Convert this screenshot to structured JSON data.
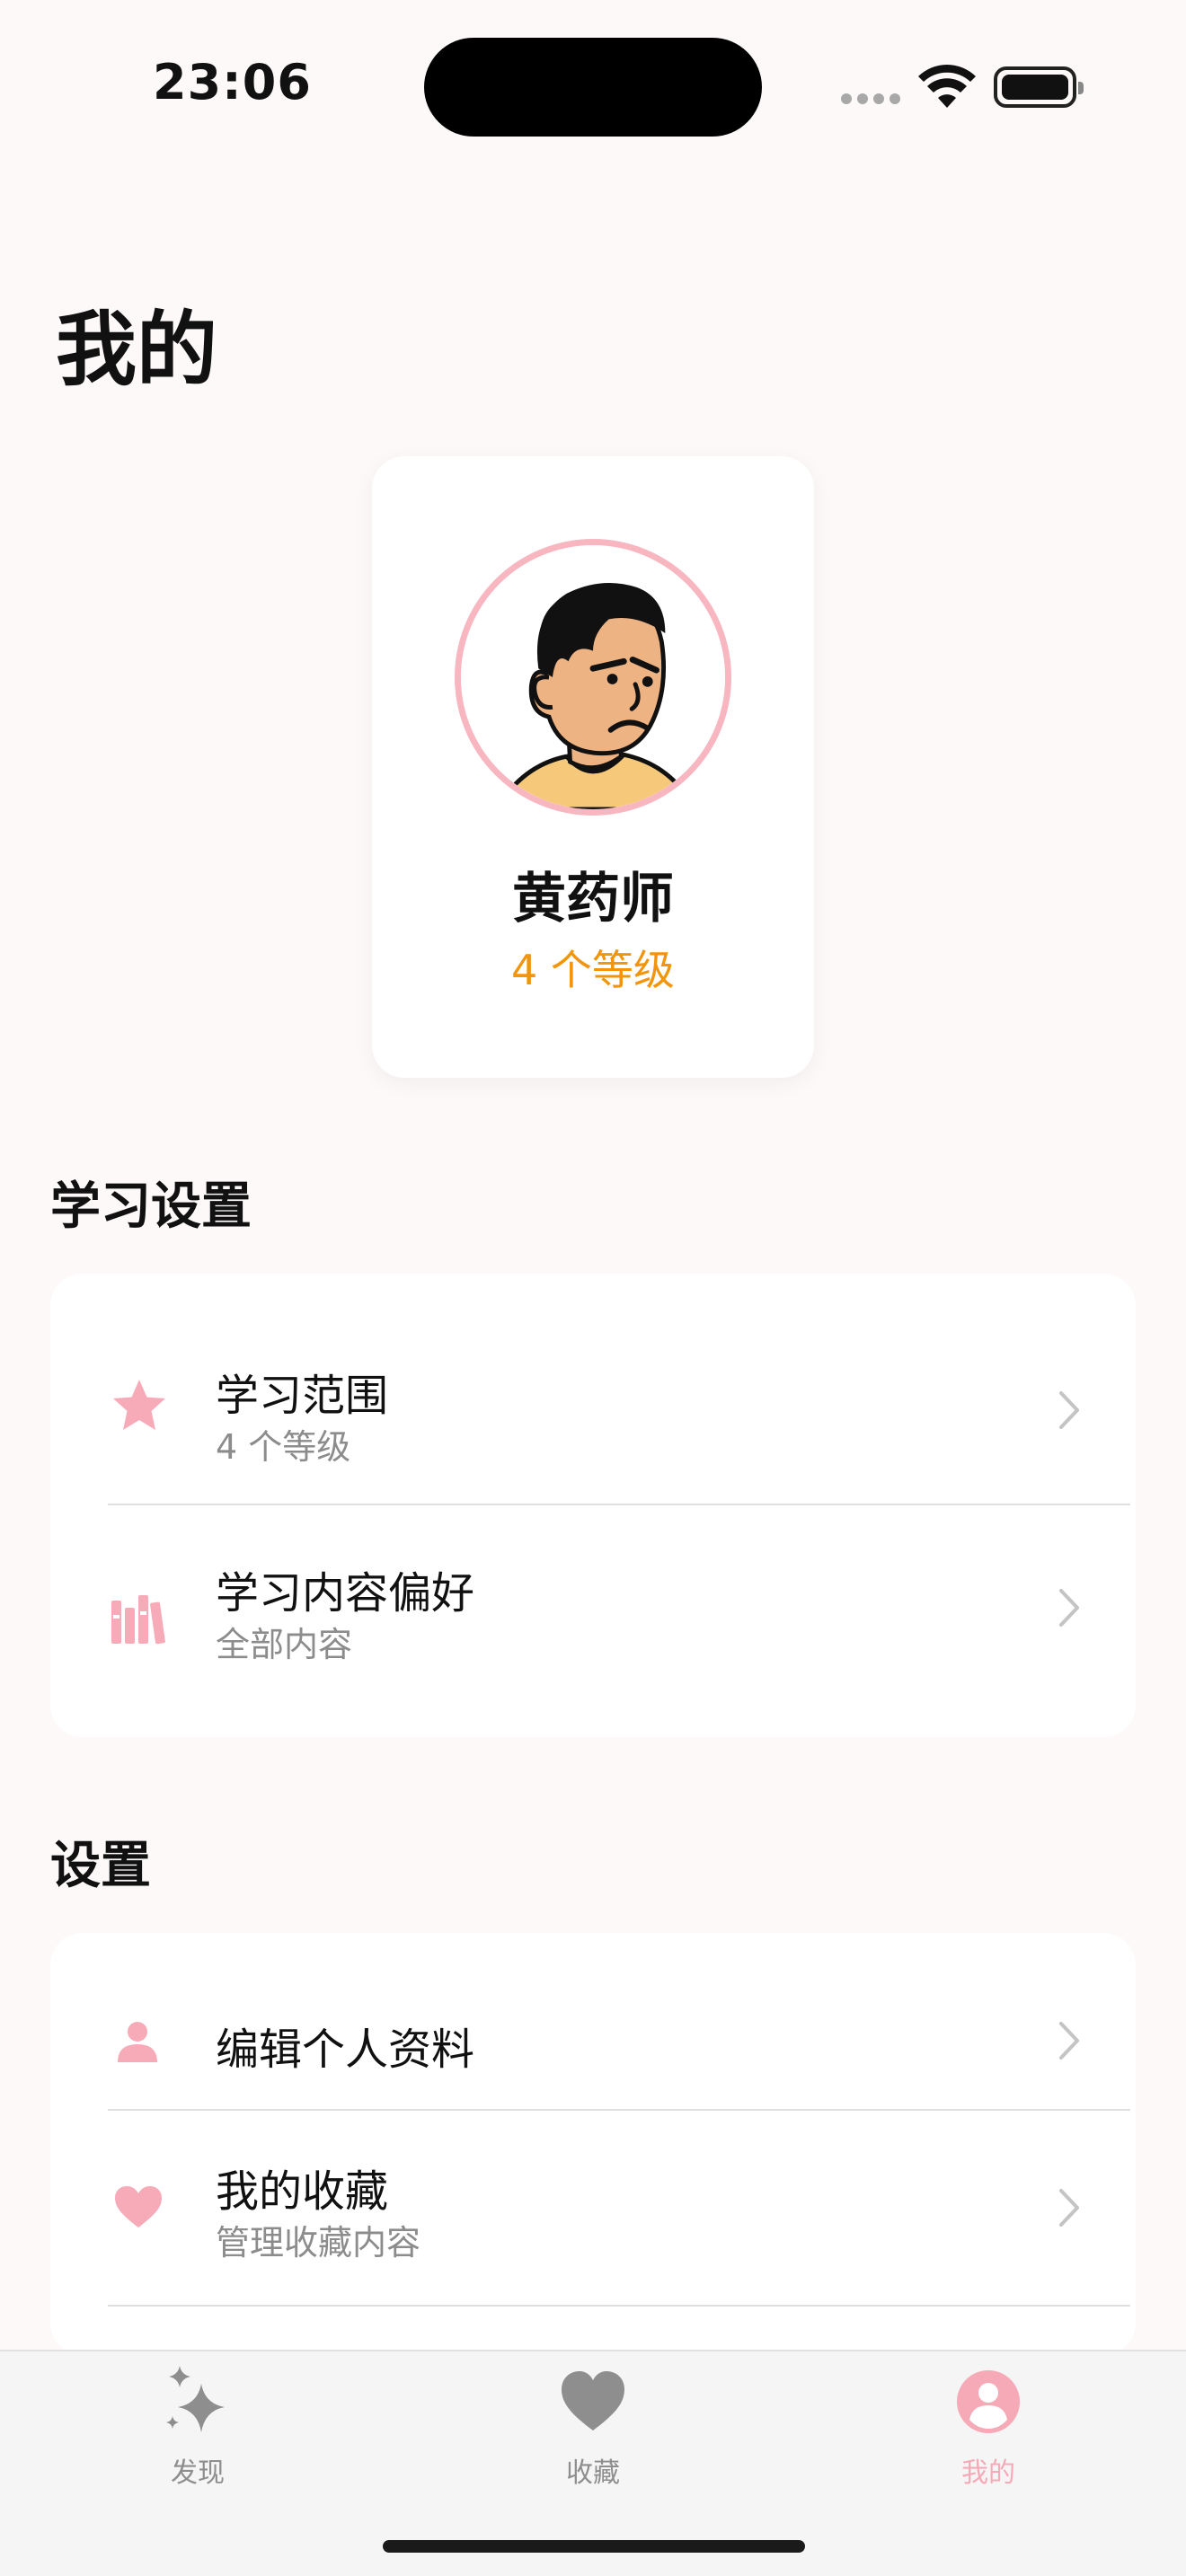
{
  "status_bar": {
    "time": "23:06",
    "icons": [
      "signal-dots-icon",
      "wifi-icon",
      "battery-icon"
    ]
  },
  "header": {
    "title": "我的"
  },
  "profile": {
    "name": "黄药师",
    "level_text": "4 个等级",
    "avatar": "grumpy-man-avatar",
    "accent_color": "#f2950c",
    "avatar_ring_color": "#f7b6c0"
  },
  "learning_settings": {
    "title": "学习设置",
    "items": [
      {
        "icon": "star-icon",
        "title": "学习范围",
        "subtitle": "4 个等级"
      },
      {
        "icon": "books-icon",
        "title": "学习内容偏好",
        "subtitle": "全部内容"
      }
    ]
  },
  "settings": {
    "title": "设置",
    "items": [
      {
        "icon": "person-icon",
        "title": "编辑个人资料"
      },
      {
        "icon": "heart-icon",
        "title": "我的收藏",
        "subtitle": "管理收藏内容"
      }
    ]
  },
  "tab_bar": {
    "tabs": [
      {
        "label": "发现",
        "icon": "sparkles-icon",
        "active": false
      },
      {
        "label": "收藏",
        "icon": "heart-icon",
        "active": false
      },
      {
        "label": "我的",
        "icon": "person-circle-icon",
        "active": true
      }
    ],
    "active_color": "#f6aab7",
    "inactive_color": "#8e8e8e"
  },
  "theme": {
    "icon_pink": "#f7aab8",
    "background": "#fdf9f9"
  }
}
